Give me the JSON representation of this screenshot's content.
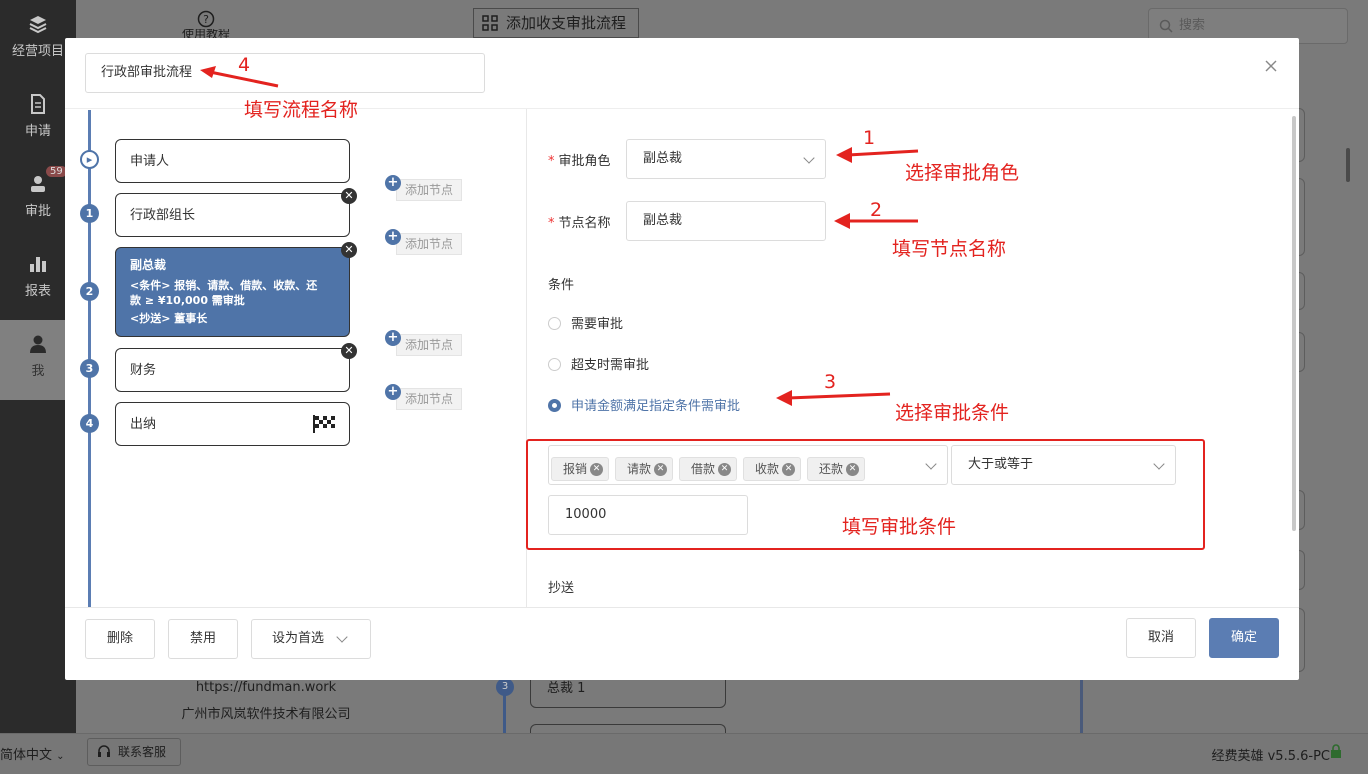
{
  "nav": {
    "items": [
      {
        "label": "经营项目",
        "icon": "layers-icon"
      },
      {
        "label": "申请",
        "icon": "document-icon"
      },
      {
        "label": "审批",
        "icon": "user-stamp-icon",
        "badge": "59"
      },
      {
        "label": "报表",
        "icon": "bar-chart-icon"
      },
      {
        "label": "我",
        "icon": "person-icon"
      }
    ]
  },
  "background": {
    "help_label": "使用教程",
    "tab_title": "添加收支审批流程",
    "search_placeholder": "搜索",
    "website": "https://fundman.work",
    "company": "广州市风岚软件技术有限公司",
    "language": "简体中文",
    "support": "联系客服",
    "version": "经费英雄 v5.5.6-PC",
    "peek_node": "总裁 1",
    "peek_step": "3"
  },
  "modal": {
    "flow_name": "行政部审批流程",
    "nodes": [
      {
        "step": "",
        "label": "申请人"
      },
      {
        "step": "1",
        "label": "行政部组长"
      },
      {
        "step": "2",
        "label": "副总裁",
        "line1": "<条件> 报销、请款、借款、收款、还",
        "line2": "款 ≥ ¥10,000 需审批",
        "line3": "<抄送> 董事长"
      },
      {
        "step": "3",
        "label": "财务"
      },
      {
        "step": "4",
        "label": "出纳"
      }
    ],
    "add_node_label": "添加节点",
    "form": {
      "role_label": "审批角色",
      "role_value": "副总裁",
      "node_name_label": "节点名称",
      "node_name_value": "副总裁",
      "condition_label": "条件",
      "radio_options": [
        "需要审批",
        "超支时需审批",
        "申请金额满足指定条件需审批"
      ],
      "tags": [
        "报销",
        "请款",
        "借款",
        "收款",
        "还款"
      ],
      "operator": "大于或等于",
      "amount": "10000",
      "cc_label": "抄送"
    },
    "footer": {
      "delete": "删除",
      "disable": "禁用",
      "set_preferred": "设为首选",
      "cancel": "取消",
      "confirm": "确定"
    }
  },
  "annotations": {
    "n1": "1",
    "t1": "选择审批角色",
    "n2": "2",
    "t2": "填写节点名称",
    "n3": "3",
    "t3": "选择审批条件",
    "n4": "4",
    "t4": "填写流程名称",
    "box": "填写审批条件"
  },
  "colors": {
    "accent": "#4f74a8",
    "annotation": "#e3231f",
    "nav_bg": "#2b2b2b"
  }
}
